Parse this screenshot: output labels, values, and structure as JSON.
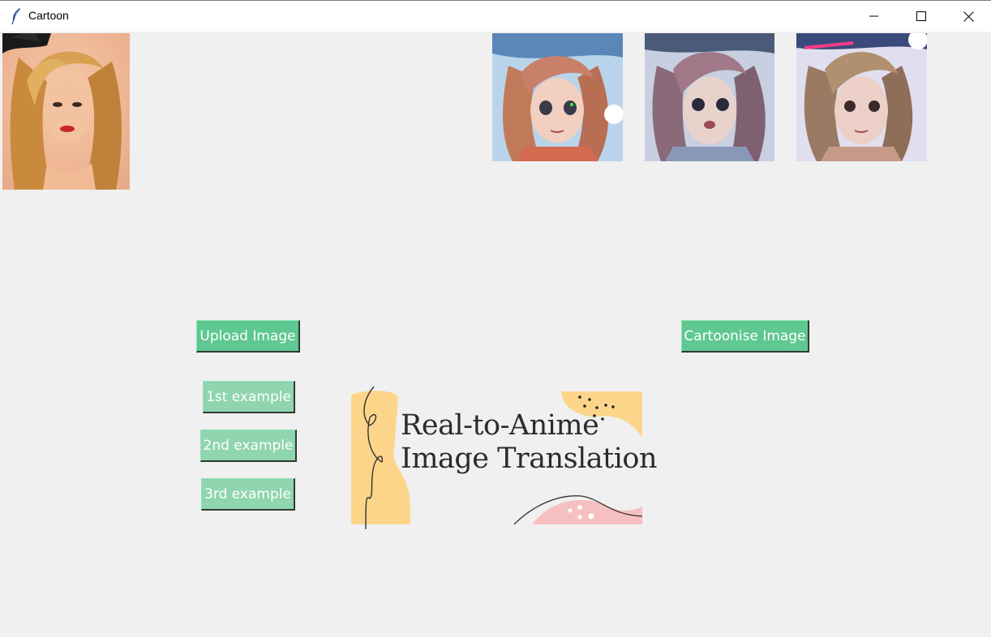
{
  "window": {
    "title": "Cartoon"
  },
  "titlebar_icons": [
    "feather-icon",
    "minimize-icon",
    "maximize-icon",
    "close-icon"
  ],
  "images": {
    "input": {
      "name": "input-photo",
      "description_colors": [
        "#f0b07a",
        "#c98a4a"
      ]
    },
    "outputs": [
      "cartoon-output-1",
      "cartoon-output-2",
      "cartoon-output-3"
    ]
  },
  "buttons": {
    "upload": "Upload Image",
    "cartoonise": "Cartoonise Image",
    "example1": "1st example",
    "example2": "2nd example",
    "example3": "3rd example"
  },
  "banner": {
    "line1": "Real-to-Anime",
    "line2": "Image Translation"
  },
  "colors": {
    "button_green": "#5ec890",
    "button_green_light": "#8fd5ad",
    "banner_yellow": "#fdd58a",
    "banner_pink": "#f7c0c0",
    "background": "#f0f0f0"
  }
}
